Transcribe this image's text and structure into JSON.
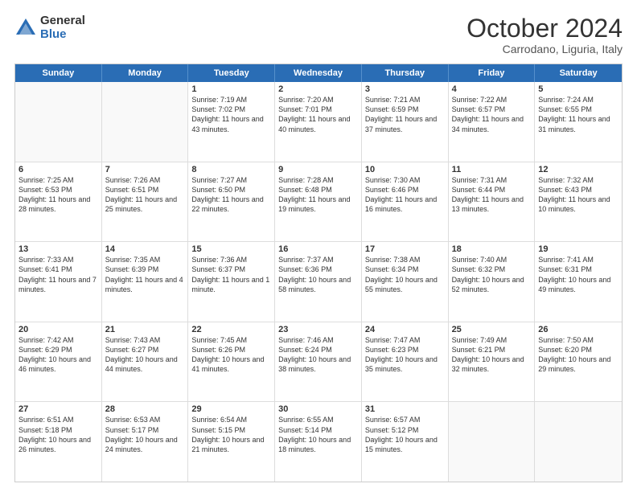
{
  "logo": {
    "general": "General",
    "blue": "Blue"
  },
  "title": "October 2024",
  "location": "Carrodano, Liguria, Italy",
  "header_days": [
    "Sunday",
    "Monday",
    "Tuesday",
    "Wednesday",
    "Thursday",
    "Friday",
    "Saturday"
  ],
  "weeks": [
    [
      {
        "day": "",
        "sunrise": "",
        "sunset": "",
        "daylight": "",
        "empty": true
      },
      {
        "day": "",
        "sunrise": "",
        "sunset": "",
        "daylight": "",
        "empty": true
      },
      {
        "day": "1",
        "sunrise": "Sunrise: 7:19 AM",
        "sunset": "Sunset: 7:02 PM",
        "daylight": "Daylight: 11 hours and 43 minutes."
      },
      {
        "day": "2",
        "sunrise": "Sunrise: 7:20 AM",
        "sunset": "Sunset: 7:01 PM",
        "daylight": "Daylight: 11 hours and 40 minutes."
      },
      {
        "day": "3",
        "sunrise": "Sunrise: 7:21 AM",
        "sunset": "Sunset: 6:59 PM",
        "daylight": "Daylight: 11 hours and 37 minutes."
      },
      {
        "day": "4",
        "sunrise": "Sunrise: 7:22 AM",
        "sunset": "Sunset: 6:57 PM",
        "daylight": "Daylight: 11 hours and 34 minutes."
      },
      {
        "day": "5",
        "sunrise": "Sunrise: 7:24 AM",
        "sunset": "Sunset: 6:55 PM",
        "daylight": "Daylight: 11 hours and 31 minutes."
      }
    ],
    [
      {
        "day": "6",
        "sunrise": "Sunrise: 7:25 AM",
        "sunset": "Sunset: 6:53 PM",
        "daylight": "Daylight: 11 hours and 28 minutes."
      },
      {
        "day": "7",
        "sunrise": "Sunrise: 7:26 AM",
        "sunset": "Sunset: 6:51 PM",
        "daylight": "Daylight: 11 hours and 25 minutes."
      },
      {
        "day": "8",
        "sunrise": "Sunrise: 7:27 AM",
        "sunset": "Sunset: 6:50 PM",
        "daylight": "Daylight: 11 hours and 22 minutes."
      },
      {
        "day": "9",
        "sunrise": "Sunrise: 7:28 AM",
        "sunset": "Sunset: 6:48 PM",
        "daylight": "Daylight: 11 hours and 19 minutes."
      },
      {
        "day": "10",
        "sunrise": "Sunrise: 7:30 AM",
        "sunset": "Sunset: 6:46 PM",
        "daylight": "Daylight: 11 hours and 16 minutes."
      },
      {
        "day": "11",
        "sunrise": "Sunrise: 7:31 AM",
        "sunset": "Sunset: 6:44 PM",
        "daylight": "Daylight: 11 hours and 13 minutes."
      },
      {
        "day": "12",
        "sunrise": "Sunrise: 7:32 AM",
        "sunset": "Sunset: 6:43 PM",
        "daylight": "Daylight: 11 hours and 10 minutes."
      }
    ],
    [
      {
        "day": "13",
        "sunrise": "Sunrise: 7:33 AM",
        "sunset": "Sunset: 6:41 PM",
        "daylight": "Daylight: 11 hours and 7 minutes."
      },
      {
        "day": "14",
        "sunrise": "Sunrise: 7:35 AM",
        "sunset": "Sunset: 6:39 PM",
        "daylight": "Daylight: 11 hours and 4 minutes."
      },
      {
        "day": "15",
        "sunrise": "Sunrise: 7:36 AM",
        "sunset": "Sunset: 6:37 PM",
        "daylight": "Daylight: 11 hours and 1 minute."
      },
      {
        "day": "16",
        "sunrise": "Sunrise: 7:37 AM",
        "sunset": "Sunset: 6:36 PM",
        "daylight": "Daylight: 10 hours and 58 minutes."
      },
      {
        "day": "17",
        "sunrise": "Sunrise: 7:38 AM",
        "sunset": "Sunset: 6:34 PM",
        "daylight": "Daylight: 10 hours and 55 minutes."
      },
      {
        "day": "18",
        "sunrise": "Sunrise: 7:40 AM",
        "sunset": "Sunset: 6:32 PM",
        "daylight": "Daylight: 10 hours and 52 minutes."
      },
      {
        "day": "19",
        "sunrise": "Sunrise: 7:41 AM",
        "sunset": "Sunset: 6:31 PM",
        "daylight": "Daylight: 10 hours and 49 minutes."
      }
    ],
    [
      {
        "day": "20",
        "sunrise": "Sunrise: 7:42 AM",
        "sunset": "Sunset: 6:29 PM",
        "daylight": "Daylight: 10 hours and 46 minutes."
      },
      {
        "day": "21",
        "sunrise": "Sunrise: 7:43 AM",
        "sunset": "Sunset: 6:27 PM",
        "daylight": "Daylight: 10 hours and 44 minutes."
      },
      {
        "day": "22",
        "sunrise": "Sunrise: 7:45 AM",
        "sunset": "Sunset: 6:26 PM",
        "daylight": "Daylight: 10 hours and 41 minutes."
      },
      {
        "day": "23",
        "sunrise": "Sunrise: 7:46 AM",
        "sunset": "Sunset: 6:24 PM",
        "daylight": "Daylight: 10 hours and 38 minutes."
      },
      {
        "day": "24",
        "sunrise": "Sunrise: 7:47 AM",
        "sunset": "Sunset: 6:23 PM",
        "daylight": "Daylight: 10 hours and 35 minutes."
      },
      {
        "day": "25",
        "sunrise": "Sunrise: 7:49 AM",
        "sunset": "Sunset: 6:21 PM",
        "daylight": "Daylight: 10 hours and 32 minutes."
      },
      {
        "day": "26",
        "sunrise": "Sunrise: 7:50 AM",
        "sunset": "Sunset: 6:20 PM",
        "daylight": "Daylight: 10 hours and 29 minutes."
      }
    ],
    [
      {
        "day": "27",
        "sunrise": "Sunrise: 6:51 AM",
        "sunset": "Sunset: 5:18 PM",
        "daylight": "Daylight: 10 hours and 26 minutes."
      },
      {
        "day": "28",
        "sunrise": "Sunrise: 6:53 AM",
        "sunset": "Sunset: 5:17 PM",
        "daylight": "Daylight: 10 hours and 24 minutes."
      },
      {
        "day": "29",
        "sunrise": "Sunrise: 6:54 AM",
        "sunset": "Sunset: 5:15 PM",
        "daylight": "Daylight: 10 hours and 21 minutes."
      },
      {
        "day": "30",
        "sunrise": "Sunrise: 6:55 AM",
        "sunset": "Sunset: 5:14 PM",
        "daylight": "Daylight: 10 hours and 18 minutes."
      },
      {
        "day": "31",
        "sunrise": "Sunrise: 6:57 AM",
        "sunset": "Sunset: 5:12 PM",
        "daylight": "Daylight: 10 hours and 15 minutes."
      },
      {
        "day": "",
        "sunrise": "",
        "sunset": "",
        "daylight": "",
        "empty": true
      },
      {
        "day": "",
        "sunrise": "",
        "sunset": "",
        "daylight": "",
        "empty": true
      }
    ]
  ]
}
